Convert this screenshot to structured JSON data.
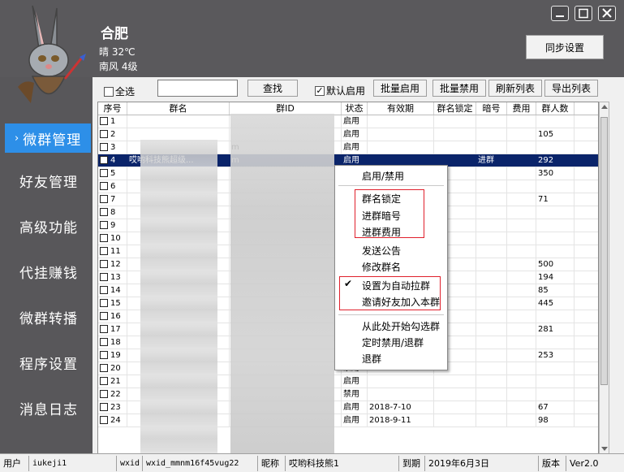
{
  "weather": {
    "city": "合肥",
    "line1": "晴  32℃",
    "line2": "南风  4级"
  },
  "window_controls": {
    "min": "▁",
    "max": "▢",
    "close": "✕"
  },
  "sync_button": "同步设置",
  "nav": [
    {
      "label": "微群管理",
      "active": true
    },
    {
      "label": "好友管理"
    },
    {
      "label": "高级功能"
    },
    {
      "label": "代挂赚钱"
    },
    {
      "label": "微群转播"
    },
    {
      "label": "程序设置"
    },
    {
      "label": "消息日志"
    }
  ],
  "nav_active_marker": "›",
  "toolbar": {
    "select_all": "全选",
    "search_placeholder": "",
    "search_btn": "查找",
    "default_enable": "默认启用",
    "batch_enable": "批量启用",
    "batch_disable": "批量禁用",
    "refresh": "刷新列表",
    "export": "导出列表"
  },
  "table": {
    "headers": [
      "序号",
      "群名",
      "群ID",
      "状态",
      "有效期",
      "群名锁定",
      "暗号",
      "费用",
      "群人数"
    ],
    "rows": [
      {
        "n": "1",
        "name": "",
        "id": "",
        "status": "启用",
        "exp": "",
        "lock": "",
        "code": "",
        "fee": "",
        "count": ""
      },
      {
        "n": "2",
        "name": "",
        "id": "",
        "status": "启用",
        "exp": "",
        "lock": "",
        "code": "",
        "fee": "",
        "count": "105"
      },
      {
        "n": "3",
        "name": "",
        "id": "m",
        "status": "启用",
        "exp": "",
        "lock": "",
        "code": "",
        "fee": "",
        "count": ""
      },
      {
        "n": "4",
        "name": "哎哟科技熊超级...",
        "id": "m",
        "status": "启用",
        "exp": "",
        "lock": "",
        "code": "进群",
        "fee": "",
        "count": "292",
        "selected": true
      },
      {
        "n": "5",
        "name": "",
        "id": "",
        "status": "",
        "exp": "",
        "lock": "",
        "code": "",
        "fee": "",
        "count": "350"
      },
      {
        "n": "6",
        "name": "",
        "id": "",
        "status": "",
        "exp": "",
        "lock": "",
        "code": "",
        "fee": "",
        "count": ""
      },
      {
        "n": "7",
        "name": "",
        "id": "",
        "status": "",
        "exp": "",
        "lock": "",
        "code": "",
        "fee": "",
        "count": "71"
      },
      {
        "n": "8",
        "name": "",
        "id": "",
        "status": "",
        "exp": "",
        "lock": "",
        "code": "",
        "fee": "",
        "count": ""
      },
      {
        "n": "9",
        "name": "",
        "id": "",
        "status": "",
        "exp": "",
        "lock": "",
        "code": "",
        "fee": "",
        "count": ""
      },
      {
        "n": "10",
        "name": "",
        "id": "",
        "status": "",
        "exp": "",
        "lock": "",
        "code": "",
        "fee": "",
        "count": ""
      },
      {
        "n": "11",
        "name": "",
        "id": "",
        "status": "",
        "exp": "",
        "lock": "",
        "code": "",
        "fee": "",
        "count": ""
      },
      {
        "n": "12",
        "name": "",
        "id": "",
        "status": "",
        "exp": "",
        "lock": "",
        "code": "",
        "fee": "",
        "count": "500"
      },
      {
        "n": "13",
        "name": "",
        "id": "",
        "status": "",
        "exp": "",
        "lock": "",
        "code": "",
        "fee": "",
        "count": "194"
      },
      {
        "n": "14",
        "name": "",
        "id": "",
        "status": "",
        "exp": "",
        "lock": "",
        "code": "",
        "fee": "",
        "count": "85"
      },
      {
        "n": "15",
        "name": "",
        "id": "",
        "status": "",
        "exp": "",
        "lock": "",
        "code": "",
        "fee": "",
        "count": "445"
      },
      {
        "n": "16",
        "name": "",
        "id": "",
        "status": "",
        "exp": "",
        "lock": "",
        "code": "",
        "fee": "",
        "count": ""
      },
      {
        "n": "17",
        "name": "",
        "id": "",
        "status": "",
        "exp": "",
        "lock": "",
        "code": "",
        "fee": "",
        "count": "281"
      },
      {
        "n": "18",
        "name": "",
        "id": "",
        "status": "",
        "exp": "",
        "lock": "",
        "code": "",
        "fee": "",
        "count": ""
      },
      {
        "n": "19",
        "name": "",
        "id": "",
        "status": "",
        "exp": "",
        "lock": "",
        "code": "",
        "fee": "",
        "count": "253"
      },
      {
        "n": "20",
        "name": "",
        "id": "",
        "status": "禁用",
        "exp": "",
        "lock": "",
        "code": "",
        "fee": "",
        "count": ""
      },
      {
        "n": "21",
        "name": "",
        "id": "",
        "status": "启用",
        "exp": "",
        "lock": "",
        "code": "",
        "fee": "",
        "count": ""
      },
      {
        "n": "22",
        "name": "",
        "id": "",
        "status": "禁用",
        "exp": "",
        "lock": "",
        "code": "",
        "fee": "",
        "count": ""
      },
      {
        "n": "23",
        "name": "",
        "id": "",
        "status": "启用",
        "exp": "2018-7-10",
        "lock": "",
        "code": "",
        "fee": "",
        "count": "67"
      },
      {
        "n": "24",
        "name": "",
        "id": "",
        "status": "启用",
        "exp": "2018-9-11",
        "lock": "",
        "code": "",
        "fee": "",
        "count": "98"
      }
    ]
  },
  "context_menu": {
    "enable_disable": "启用/禁用",
    "lock_name": "群名锁定",
    "join_code": "进群暗号",
    "join_fee": "进群费用",
    "announce": "发送公告",
    "rename": "修改群名",
    "auto_pull": "设置为自动拉群",
    "auto_pull_check": "✔",
    "invite_friends": "邀请好友加入本群",
    "select_from_here": "从此处开始勾选群",
    "timed_disable": "定时禁用/退群",
    "quit": "退群"
  },
  "status_bar": {
    "user_label": "用户",
    "user": "iukeji1",
    "wxid_label": "wxid",
    "wxid": "wxid_mmnm16f45vug22",
    "nick_label": "昵称",
    "nick": "哎哟科技熊1",
    "expire_label": "到期",
    "expire": "2019年6月3日",
    "version_label": "版本",
    "version": "Ver2.0"
  },
  "colors": {
    "bg_dark": "#58575a",
    "nav_active": "#2d8fe8",
    "selected_row": "#0a246a",
    "highlight": "#e0202c"
  }
}
